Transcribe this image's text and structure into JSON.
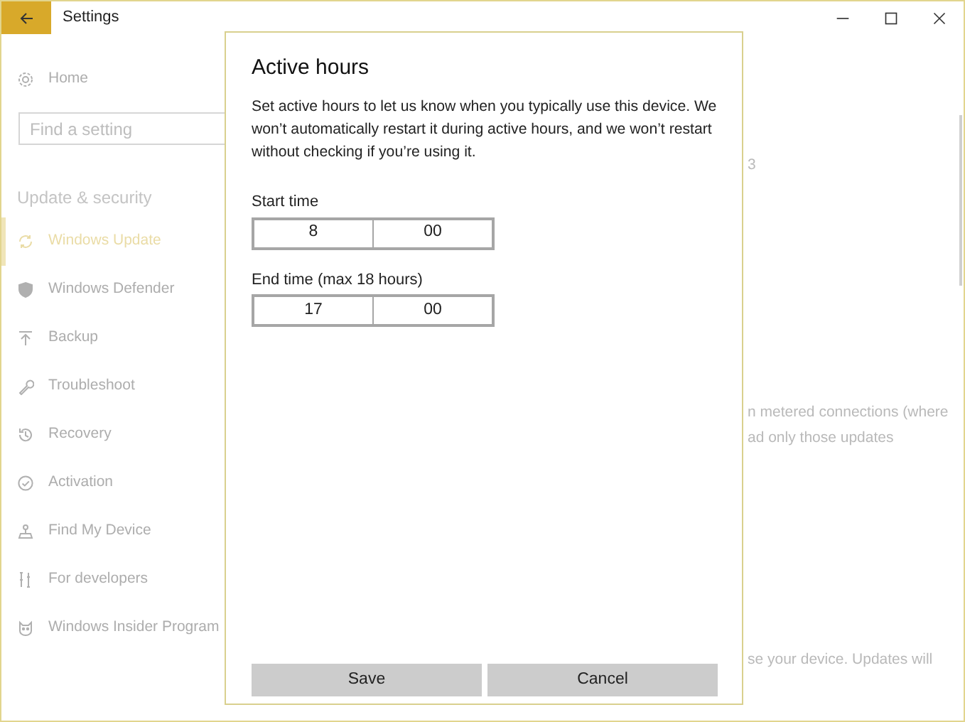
{
  "window": {
    "title": "Settings"
  },
  "sidebar": {
    "home": "Home",
    "search": {
      "placeholder": "Find a setting"
    },
    "section_header": "Update & security",
    "items": [
      {
        "label": "Windows Update",
        "selected": true
      },
      {
        "label": "Windows Defender",
        "selected": false
      },
      {
        "label": "Backup",
        "selected": false
      },
      {
        "label": "Troubleshoot",
        "selected": false
      },
      {
        "label": "Recovery",
        "selected": false
      },
      {
        "label": "Activation",
        "selected": false
      },
      {
        "label": "Find My Device",
        "selected": false
      },
      {
        "label": "For developers",
        "selected": false
      },
      {
        "label": "Windows Insider Program",
        "selected": false
      }
    ]
  },
  "background_fragments": [
    "3",
    "n metered connections (where",
    "ad only those updates",
    "se your device. Updates will"
  ],
  "dialog": {
    "title": "Active hours",
    "description": "Set active hours to let us know when you typically use this device. We won’t automatically restart it during active hours, and we won’t restart without checking if you’re using it.",
    "fields": [
      {
        "label": "Start time",
        "hour": "8",
        "minute": "00"
      },
      {
        "label": "End time (max 18 hours)",
        "hour": "17",
        "minute": "00"
      }
    ],
    "buttons": [
      "Save",
      "Cancel"
    ]
  }
}
